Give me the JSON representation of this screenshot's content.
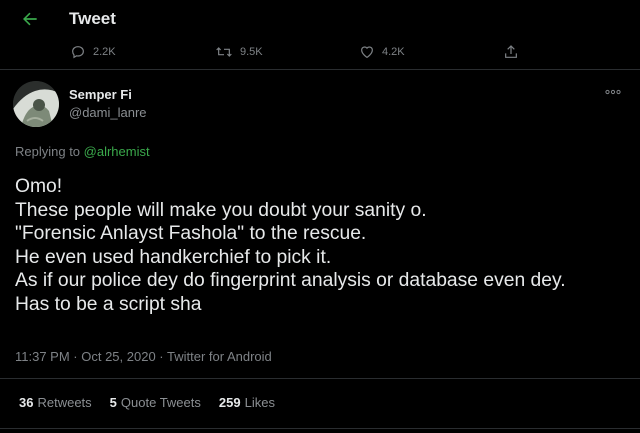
{
  "header": {
    "title": "Tweet"
  },
  "prev_actions": {
    "replies": "2.2K",
    "retweets": "9.5K",
    "likes": "4.2K"
  },
  "user": {
    "name": "Semper Fi",
    "handle": "@dami_lanre"
  },
  "reply": {
    "prefix": "Replying to ",
    "to": "@alrhemist"
  },
  "tweet": {
    "lines": [
      "Omo!",
      "These people will make you doubt your sanity o.",
      "\"Forensic Anlayst Fashola\" to the rescue.",
      "He even used handkerchief to pick it.",
      "As if our police dey do fingerprint analysis or database even dey.",
      "Has to be a script sha"
    ]
  },
  "meta": {
    "text": "11:37 PM · Oct 25, 2020 · Twitter for Android"
  },
  "stats": {
    "retweets_count": "36",
    "retweets_label": "Retweets",
    "quotes_count": "5",
    "quotes_label": "Quote Tweets",
    "likes_count": "259",
    "likes_label": "Likes"
  },
  "colors": {
    "background": "#000000",
    "accent_green": "#3aa84b",
    "muted": "#7e8286",
    "text": "#e7e9ea"
  },
  "icons": [
    "back-arrow-icon",
    "reply-icon",
    "retweet-icon",
    "like-icon",
    "share-icon",
    "more-icon"
  ]
}
